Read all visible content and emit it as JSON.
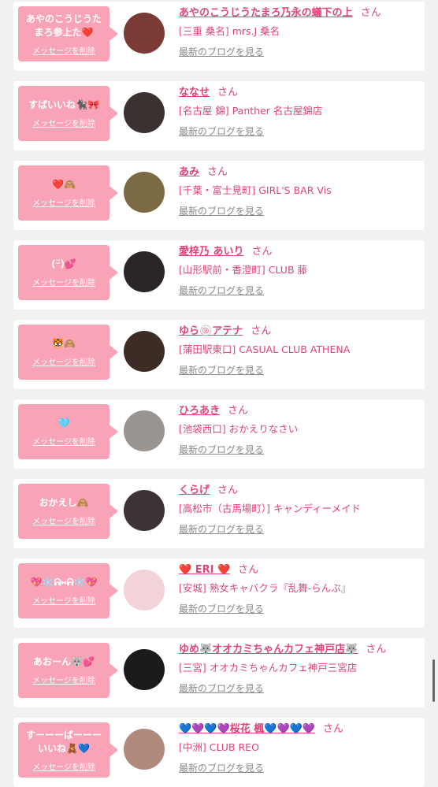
{
  "accent": "#e0447a",
  "bubble_color": "#f9a3b6",
  "delete_label": "メッセージを削除",
  "blog_label": "最新のブログを見る",
  "san_label": "さん",
  "items": [
    {
      "message": "あやのこうじうたまろ参上た❤️",
      "name": "あやのこうじうたまろ乃永の蟻下の上",
      "shop": "[三重 桑名] mrs.J 桑名",
      "avatar_color": "#7a3b36",
      "avatar_icon": "portrait"
    },
    {
      "message": "すばいいね🐈‍⬛🎀",
      "name": "ななせ",
      "shop": "[名古屋 錦] Panther 名古屋錦店",
      "avatar_color": "#3a3230",
      "avatar_icon": "portrait"
    },
    {
      "message": "❤️🙈",
      "name": "あみ",
      "shop": "[千葉・富士見町] GIRL'S BAR Vis",
      "avatar_color": "#7b6a44",
      "avatar_icon": "tiger-photo"
    },
    {
      "message": "(ᵕ̈)💕",
      "name": "愛梓乃 あいり",
      "shop": "[山形駅前・香澄町] CLUB 藤",
      "avatar_color": "#2c2528",
      "avatar_icon": "portrait"
    },
    {
      "message": "🐯🙈",
      "name": "ゆら🍥アテナ",
      "shop": "[蒲田駅東口] CASUAL CLUB ATHENA",
      "avatar_color": "#3d2c26",
      "avatar_icon": "portrait"
    },
    {
      "message": "🩵",
      "name": "ひろあき",
      "shop": "[池袋西口] おかえりなさい",
      "avatar_color": "#9a9590",
      "avatar_icon": "portrait"
    },
    {
      "message": "おかえし🙈",
      "name": "くらげ",
      "shop": "[高松市（古馬場町）] キャンディーメイド",
      "avatar_color": "#3b3338",
      "avatar_icon": "portrait"
    },
    {
      "message": "💖❄️ᕱ⑅ᕱ❄️💖",
      "name": "❤️ ERI ❤️",
      "shop": "[安城] 熟女キャバクラ『乱舞-らんぶ』",
      "avatar_color": "#f2d4d8",
      "avatar_icon": "portrait"
    },
    {
      "message": "あおーん🐺💕",
      "name": "ゆめ🐺オオカミちゃんカフェ神戸店🐺",
      "shop": "[三宮] オオカミちゃんカフェ神戸三宮店",
      "avatar_color": "#1d1a1a",
      "avatar_icon": "portrait"
    },
    {
      "message": "すーーーばーーーいいね🧸💙",
      "name": "💙💜💙💜桜花 楓💙💜💙💜",
      "shop": "[中洲] CLUB REO",
      "avatar_color": "#b08a7a",
      "avatar_icon": "portrait"
    }
  ]
}
